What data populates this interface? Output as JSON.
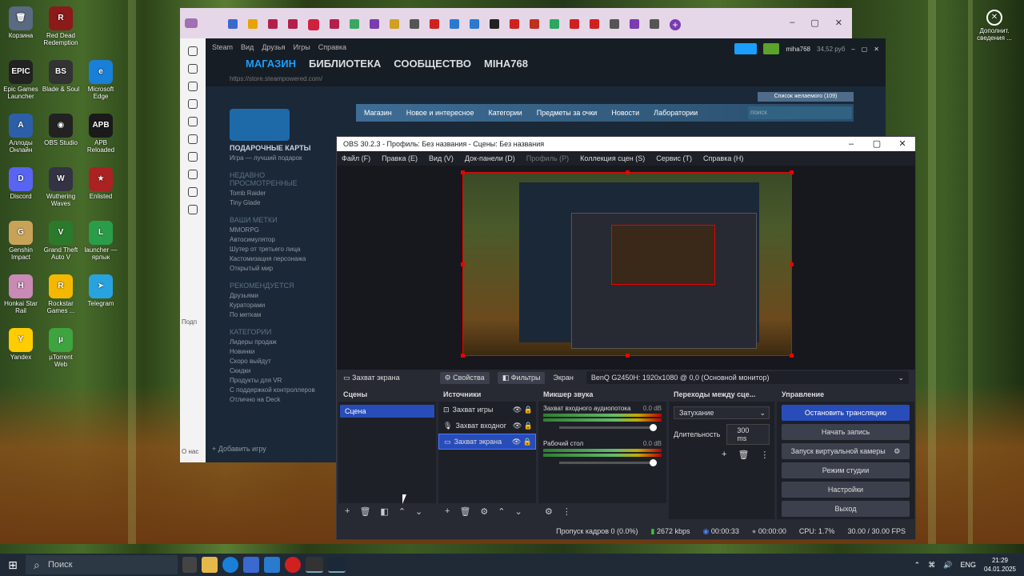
{
  "desktop": {
    "icons": [
      {
        "label": "Корзина",
        "color": "#5a6a80",
        "glyph": "🗑"
      },
      {
        "label": "Red Dead Redemption",
        "color": "#8b1a1a",
        "glyph": "R"
      },
      {
        "label": "Epic Games Launcher",
        "color": "#222222",
        "glyph": "EPIC"
      },
      {
        "label": "Blade & Soul",
        "color": "#333333",
        "glyph": "BS"
      },
      {
        "label": "Microsoft Edge",
        "color": "#1a7fd6",
        "glyph": "e"
      },
      {
        "label": "Аллоды Онлайн",
        "color": "#2d5fa8",
        "glyph": "A"
      },
      {
        "label": "OBS Studio",
        "color": "#222222",
        "glyph": "◉"
      },
      {
        "label": "APB Reloaded",
        "color": "#1a1a1a",
        "glyph": "APB"
      },
      {
        "label": "Discord",
        "color": "#5865f2",
        "glyph": "D"
      },
      {
        "label": "Wuthering Waves",
        "color": "#333344",
        "glyph": "W"
      },
      {
        "label": "Enlisted",
        "color": "#aa2222",
        "glyph": "★"
      },
      {
        "label": "Genshin Impact",
        "color": "#c9a25a",
        "glyph": "G"
      },
      {
        "label": "Grand Theft Auto V",
        "color": "#2b7a2b",
        "glyph": "V"
      },
      {
        "label": "launcher — ярлык",
        "color": "#2a9d4a",
        "glyph": "L"
      },
      {
        "label": "Honkai Star Rail",
        "color": "#c98ab5",
        "glyph": "H"
      },
      {
        "label": "Rockstar Games ...",
        "color": "#f5b800",
        "glyph": "R"
      },
      {
        "label": "Telegram",
        "color": "#29a3df",
        "glyph": "➤"
      },
      {
        "label": "Yandex",
        "color": "#ffcc00",
        "glyph": "Y"
      },
      {
        "label": "µTorrent Web",
        "color": "#3fa33f",
        "glyph": "µ"
      }
    ]
  },
  "right_desktop": {
    "label": "Дополнит. сведения ..."
  },
  "steam": {
    "menu": [
      "Steam",
      "Вид",
      "Друзья",
      "Игры",
      "Справка"
    ],
    "tabs": [
      "МАГАЗИН",
      "БИБЛИОТЕКА",
      "СООБЩЕСТВО",
      "MIHA768"
    ],
    "url": "https://store.steampowered.com/",
    "user": "miha768",
    "balance": "34,52 руб",
    "wishlist": "Список желаемого (109)",
    "nav": [
      "Магазин",
      "Новое и интересное",
      "Категории",
      "Предметы за очки",
      "Новости",
      "Лаборатории"
    ],
    "search_placeholder": "поиск",
    "gift_title": "ПОДАРОЧНЫЕ КАРТЫ",
    "gift_sub": "Игра — лучший подарок",
    "recent_head": "НЕДАВНО ПРОСМОТРЕННЫЕ",
    "recent": [
      "Tomb Raider",
      "Tiny Glade"
    ],
    "tags_head": "ВАШИ МЕТКИ",
    "tags": [
      "MMORPG",
      "Автосимулятор",
      "Шутер от третьего лица",
      "Кастомизация персонажа",
      "Открытый мир"
    ],
    "rec_head": "РЕКОМЕНДУЕТСЯ",
    "rec": [
      "Друзьями",
      "Кураторами",
      "По меткам"
    ],
    "cat_head": "КАТЕГОРИИ",
    "cats": [
      "Лидеры продаж",
      "Новинки",
      "Скоро выйдут",
      "Скидки",
      "Продукты для VR",
      "С поддержкой контроллеров",
      "Отлично на Deck"
    ],
    "add_game": "Добавить игру",
    "left_labels": [
      "Подп",
      "О нас"
    ]
  },
  "obs": {
    "title": "OBS 30.2.3 - Профиль: Без названия - Сцены: Без названия",
    "menu": [
      "Файл (F)",
      "Правка (E)",
      "Вид (V)",
      "Док-панели (D)",
      "Профиль (P)",
      "Коллекция сцен (S)",
      "Сервис (T)",
      "Справка (H)"
    ],
    "source_name": "Захват экрана",
    "props": "Свойства",
    "filters": "Фильтры",
    "screen_label": "Экран",
    "monitor": "BenQ G2450H: 1920x1080 @ 0,0 (Основной монитор)",
    "scenes_head": "Сцены",
    "scenes": [
      "Сцена"
    ],
    "sources_head": "Источники",
    "sources": [
      "Захват игры",
      "Захват входног",
      "Захват экрана"
    ],
    "mixer_head": "Микшер звука",
    "mixer": [
      {
        "name": "Захват входного аудиопотока",
        "db": "0.0 dB"
      },
      {
        "name": "Рабочий стол",
        "db": "0.0 dB"
      }
    ],
    "trans_head": "Переходы между сце...",
    "transition": "Затухание",
    "duration_label": "Длительность",
    "duration": "300 ms",
    "ctrl_head": "Управление",
    "ctrl": [
      "Остановить трансляцию",
      "Начать запись",
      "Запуск виртуальной камеры",
      "Режим студии",
      "Настройки",
      "Выход"
    ],
    "status": {
      "dropped": "Пропуск кадров 0 (0.0%)",
      "kbps": "2672 kbps",
      "stream_time": "00:00:33",
      "rec_time": "00:00:00",
      "cpu": "CPU: 1.7%",
      "fps": "30.00 / 30.00 FPS"
    }
  },
  "taskbar": {
    "search": "Поиск",
    "lang": "ENG",
    "time": "21:29",
    "date": "04.01.2025"
  }
}
